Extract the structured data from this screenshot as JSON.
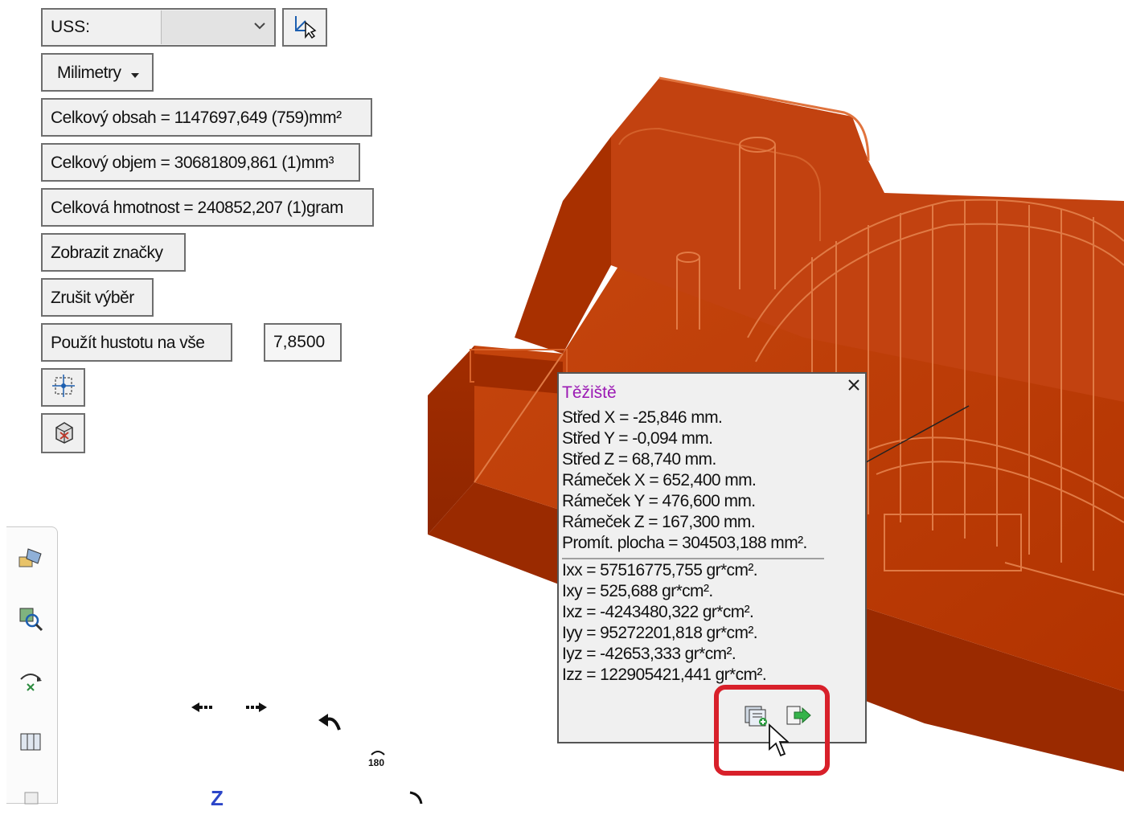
{
  "toolbar": {
    "uss_label": "USS:",
    "uss_value": "",
    "units_label": "Milimetry",
    "total_area": "Celkový obsah = 1147697,649 (759)mm²",
    "total_volume": "Celkový objem = 30681809,861 (1)mm³",
    "total_mass": "Celková hmotnost = 240852,207 (1)gram",
    "show_markers": "Zobrazit značky",
    "cancel_selection": "Zrušit výběr",
    "apply_density": "Použít hustotu na vše",
    "density_value": "7,8500"
  },
  "panel": {
    "title": "Těžiště",
    "lines": [
      "Střed X = -25,846 mm.",
      "Střed Y = -0,094 mm.",
      "Střed Z = 68,740 mm.",
      "Rámeček X = 652,400 mm.",
      "Rámeček Y = 476,600 mm.",
      "Rámeček Z = 167,300 mm.",
      "Promít. plocha = 304503,188 mm²."
    ],
    "inertia": [
      "Ixx = 57516775,755 gr*cm².",
      "Ixy = 525,688 gr*cm².",
      "Ixz = -4243480,322 gr*cm².",
      "Iyy = 95272201,818 gr*cm².",
      "Iyz = -42653,333 gr*cm².",
      "Izz = 122905421,441 gr*cm²."
    ]
  },
  "viewport": {
    "axis_label": "Z",
    "rotate_label": "180"
  },
  "colors": {
    "model": "#b83500",
    "highlight": "#d8202a",
    "title": "#9b19b4"
  }
}
